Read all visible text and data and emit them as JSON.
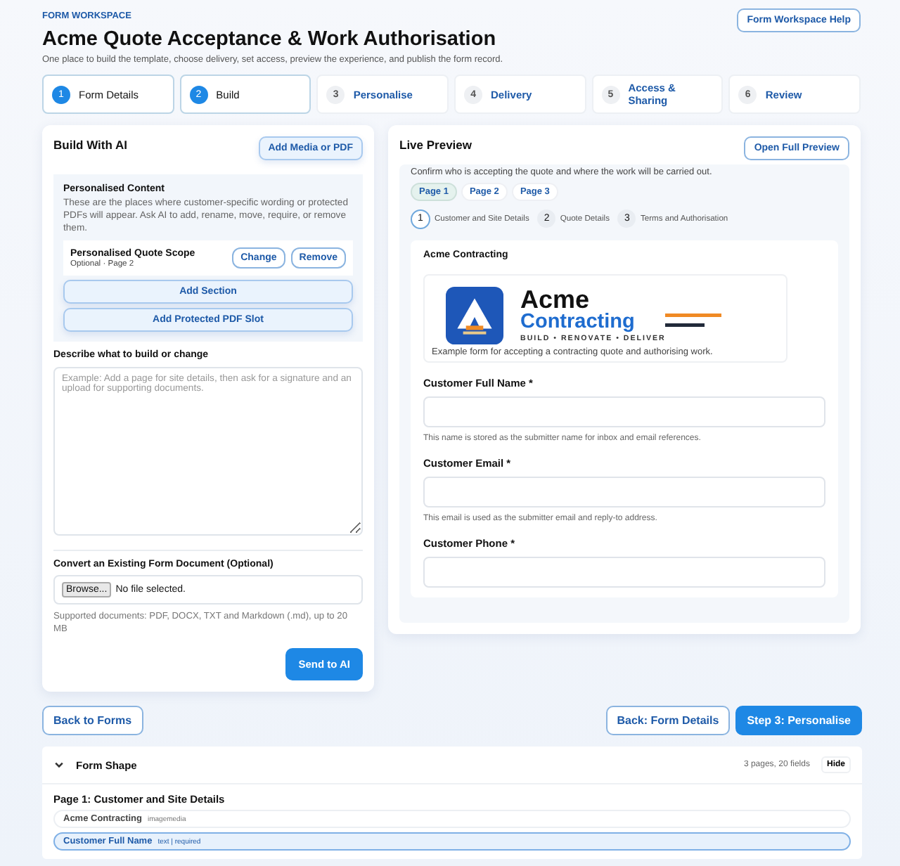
{
  "header": {
    "eyebrow": "FORM WORKSPACE",
    "title": "Acme Quote Acceptance & Work Authorisation",
    "subtitle": "One place to build the template, choose delivery, set access, preview the experience, and publish the form record.",
    "help_button": "Form Workspace Help"
  },
  "steps": [
    {
      "number": "1",
      "label": "Form Details",
      "completed": true
    },
    {
      "number": "2",
      "label": "Build",
      "completed": true
    },
    {
      "number": "3",
      "label": "Personalise",
      "completed": false
    },
    {
      "number": "4",
      "label": "Delivery",
      "completed": false
    },
    {
      "number": "5",
      "label": "Access & Sharing",
      "completed": false
    },
    {
      "number": "6",
      "label": "Review",
      "completed": false
    }
  ],
  "build": {
    "title": "Build With AI",
    "media_button": "Add Media or PDF",
    "personalised": {
      "title": "Personalised Content",
      "description": "These are the places where customer-specific wording or protected PDFs will appear. Ask AI to add, rename, move, require, or remove them.",
      "items": [
        {
          "name": "Personalised Quote Scope",
          "meta": "Optional · Page 2",
          "actions": [
            "Change",
            "Remove"
          ]
        }
      ],
      "buttons": [
        "Add Section",
        "Add Protected PDF Slot"
      ]
    },
    "prompt_label": "Describe what to build or change",
    "prompt_placeholder": "Example: Add a page for site details, then ask for a signature and an upload for supporting documents.",
    "convert_label": "Convert an Existing Form Document (Optional)",
    "browse_button": "Browse...",
    "file_status": "No file selected.",
    "supported": "Supported documents: PDF, DOCX, TXT and Markdown (.md), up to 20 MB",
    "send_button": "Send to AI"
  },
  "preview": {
    "title": "Live Preview",
    "open_button": "Open Full Preview",
    "intro": "Confirm who is accepting the quote and where the work will be carried out.",
    "pages": [
      {
        "label": "Page 1",
        "selected": true
      },
      {
        "label": "Page 2",
        "selected": false
      },
      {
        "label": "Page 3",
        "selected": false
      }
    ],
    "progress": [
      {
        "number": "1",
        "label": "Customer and Site Details",
        "selected": true
      },
      {
        "number": "2",
        "label": "Quote Details",
        "selected": false
      },
      {
        "number": "3",
        "label": "Terms and Authorisation",
        "selected": false
      }
    ],
    "card_title": "Acme Contracting",
    "logo": {
      "word1": "Acme",
      "word2": "Contracting",
      "tagline": "BUILD • RENOVATE • DELIVER"
    },
    "caption": "Example form for accepting a contracting quote and authorising work.",
    "fields": [
      {
        "label": "Customer Full Name *",
        "help": "This name is stored as the submitter name for inbox and email references."
      },
      {
        "label": "Customer Email *",
        "help": "This email is used as the submitter email and reply-to address."
      },
      {
        "label": "Customer Phone *"
      }
    ]
  },
  "nav": {
    "back_forms": "Back to Forms",
    "back_step": "Back: Form Details",
    "next_step": "Step 3: Personalise"
  },
  "form_shape": {
    "title": "Form Shape",
    "expanded": true,
    "summary": "3 pages, 20 fields",
    "hide_button": "Hide",
    "page_title": "Page 1: Customer and Site Details",
    "items": [
      {
        "name": "Acme Contracting",
        "meta": "imagemedia",
        "selected": false
      },
      {
        "name": "Customer Full Name",
        "meta": "text | required",
        "selected": true
      }
    ]
  }
}
